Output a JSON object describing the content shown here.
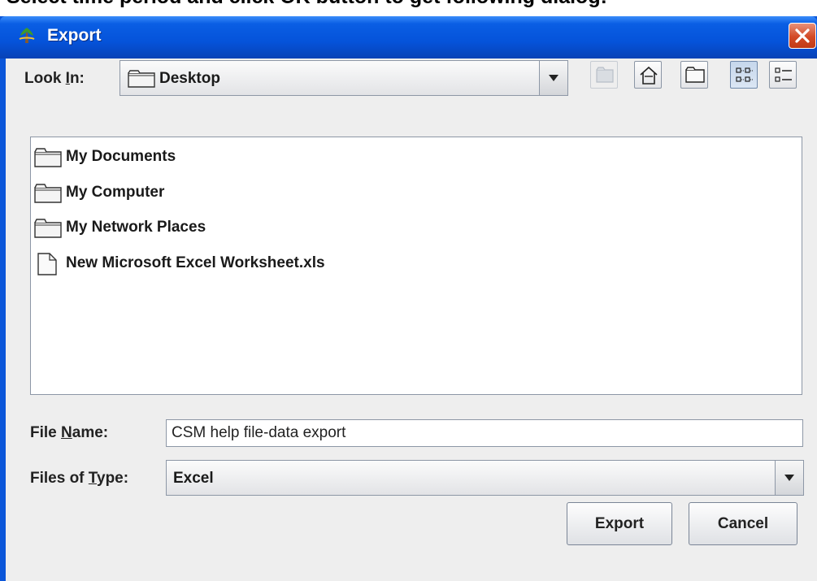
{
  "caption": "Select time period and click OK button to get following dialog:",
  "window": {
    "title": "Export"
  },
  "look_in": {
    "label_pre": "Look ",
    "label_mnemonic": "I",
    "label_post": "n:",
    "value": "Desktop",
    "icon": "folder-icon"
  },
  "toolbar": {
    "buttons": [
      {
        "name": "up-one-level-icon",
        "enabled": false
      },
      {
        "name": "home-icon",
        "enabled": true
      },
      {
        "name": "new-folder-icon",
        "enabled": true
      },
      {
        "name": "list-view-icon",
        "enabled": true,
        "selected": true
      },
      {
        "name": "details-view-icon",
        "enabled": true
      }
    ]
  },
  "files": [
    {
      "name": "My Documents",
      "icon": "folder-icon"
    },
    {
      "name": "My Computer",
      "icon": "folder-icon"
    },
    {
      "name": "My Network Places",
      "icon": "folder-icon"
    },
    {
      "name": "New Microsoft Excel Worksheet.xls",
      "icon": "file-icon"
    }
  ],
  "file_name": {
    "label_pre": "File ",
    "label_mnemonic": "N",
    "label_post": "ame:",
    "value": "CSM help file-data export"
  },
  "file_type": {
    "label_pre": "Files of ",
    "label_mnemonic": "T",
    "label_post": "ype:",
    "value": "Excel"
  },
  "buttons": {
    "export": "Export",
    "cancel": "Cancel"
  }
}
